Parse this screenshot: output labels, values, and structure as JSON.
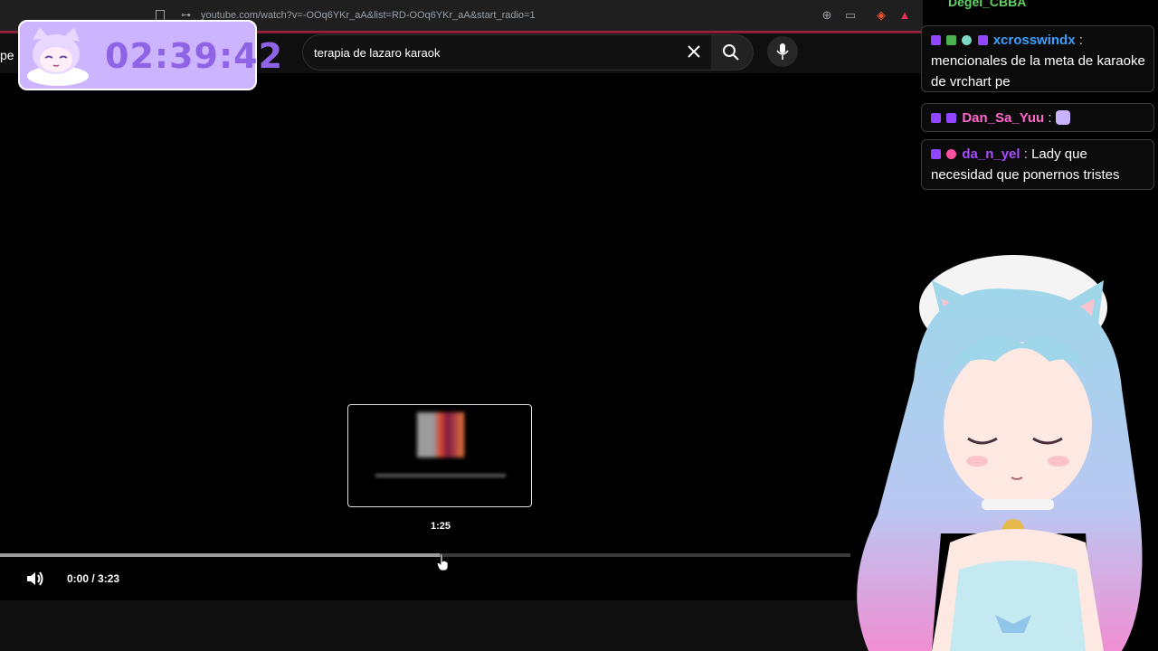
{
  "browser": {
    "url": "youtube.com/watch?v=-OOq6YKr_aA&list=RD-OOq6YKr_aA&start_radio=1"
  },
  "youtube": {
    "logo_partial": "pe",
    "search_value": "terapia de lazaro karaok"
  },
  "timer": {
    "time": "02:39:42"
  },
  "chat": {
    "top_name": "Degel_CBBA",
    "messages": [
      {
        "user": "xcrosswindx",
        "name_color": "#3aa0ff",
        "text": "mencionales de la meta de karaoke de vrchart pe"
      },
      {
        "user": "Dan_Sa_Yuu",
        "name_color": "#ff66cc",
        "text": ""
      },
      {
        "user": "da_n_yel",
        "name_color": "#a64dff",
        "text": "Lady que necesidad que ponernos tristes"
      }
    ]
  },
  "player": {
    "preview_time": "1:25",
    "time_current": "0:00",
    "time_separator": " / ",
    "time_total": "3:23",
    "hover_progress": 0.52
  },
  "colors": {
    "timer_bg": "#cdb4ff",
    "timer_text": "#8f63e6"
  }
}
